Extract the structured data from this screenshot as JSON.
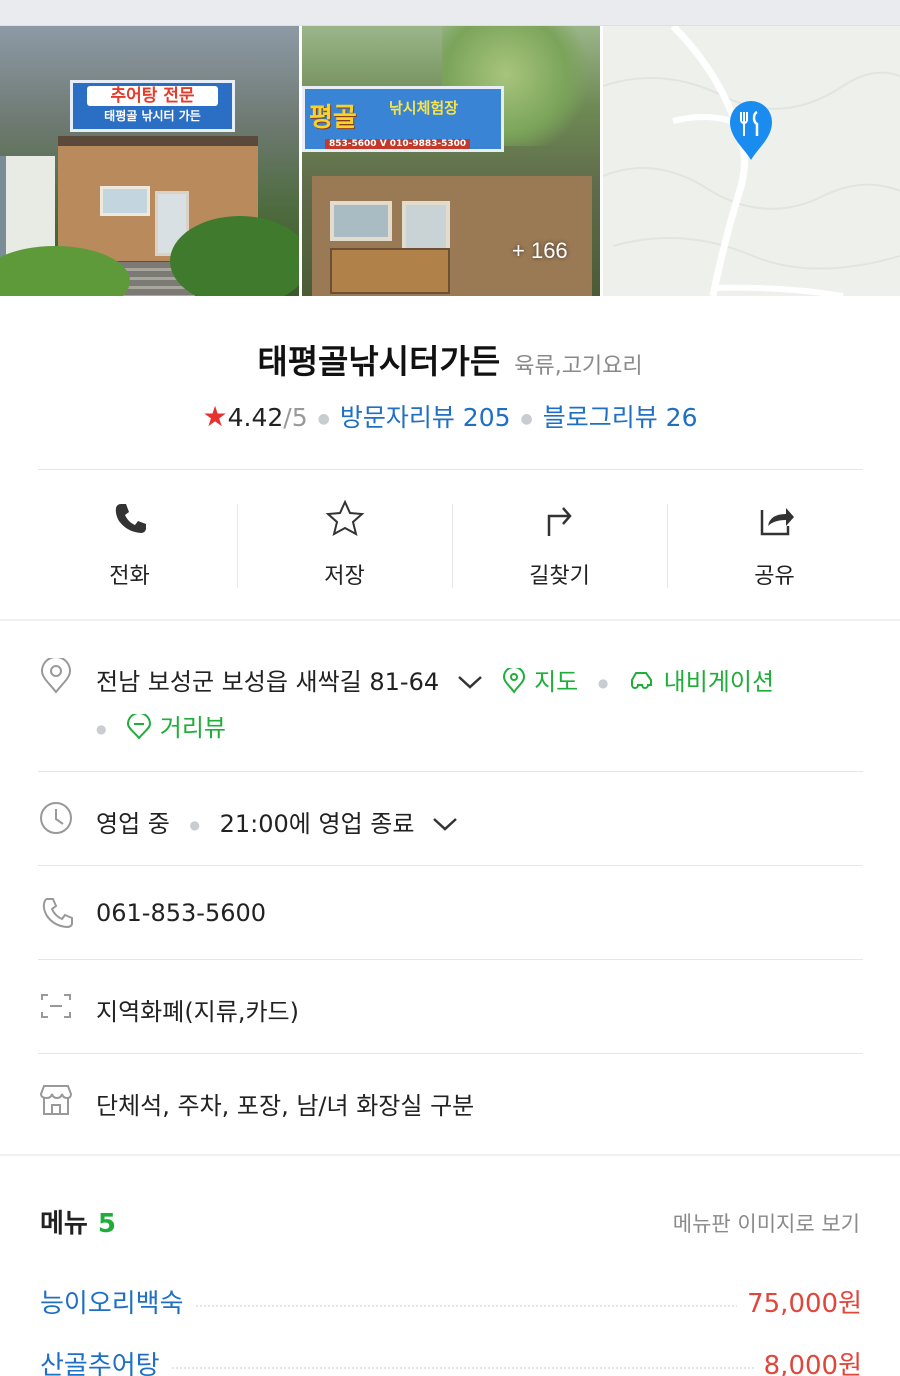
{
  "photos": {
    "sign1_line1": "추어탕 전문",
    "sign1_line2": "태평골 낚시터 가든",
    "sign2_text": "평골",
    "sign2_sub": "낚시체험장",
    "sign2_phone": "853-5600 V 010-9883-5300",
    "more_count": "+ 166"
  },
  "place": {
    "name": "태평골낚시터가든",
    "category": "육류,고기요리",
    "rating": "4.42",
    "rating_max": "/5",
    "visitor_reviews": "방문자리뷰 205",
    "blog_reviews": "블로그리뷰 26"
  },
  "actions": {
    "call": "전화",
    "save": "저장",
    "directions": "길찾기",
    "share": "공유"
  },
  "info": {
    "address": "전남 보성군 보성읍 새싹길 81-64",
    "map_link": "지도",
    "navigation_link": "내비게이션",
    "street_view_link": "거리뷰",
    "hours_status": "영업 중",
    "hours_detail": "21:00에 영업 종료",
    "phone": "061-853-5600",
    "payment": "지역화폐(지류,카드)",
    "amenities": "단체석, 주차, 포장, 남/녀 화장실 구분"
  },
  "menu": {
    "title": "메뉴",
    "count": "5",
    "view_image_link": "메뉴판 이미지로 보기",
    "items": [
      {
        "name": "능이오리백숙",
        "price": "75,000원"
      },
      {
        "name": "산골추어탕",
        "price": "8,000원"
      }
    ]
  },
  "colors": {
    "link_blue": "#1f6fc4",
    "accent_green": "#1fae3a",
    "price_red": "#e0463a",
    "star_red": "#e8322f",
    "pin_blue": "#1a8cf0"
  }
}
